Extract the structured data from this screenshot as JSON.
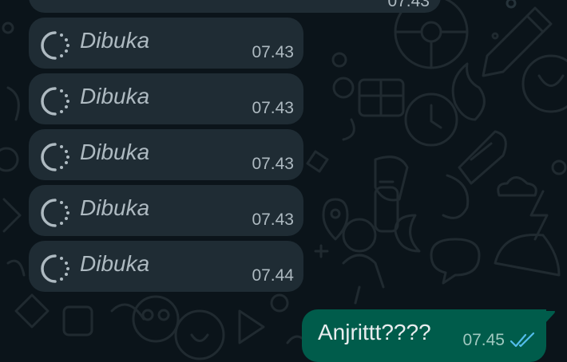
{
  "chat": {
    "top_partial_time": "07.43",
    "messages": [
      {
        "direction": "in",
        "icon": "view-once-icon",
        "text": "Dibuka",
        "time": "07.43"
      },
      {
        "direction": "in",
        "icon": "view-once-icon",
        "text": "Dibuka",
        "time": "07.43"
      },
      {
        "direction": "in",
        "icon": "view-once-icon",
        "text": "Dibuka",
        "time": "07.43"
      },
      {
        "direction": "in",
        "icon": "view-once-icon",
        "text": "Dibuka",
        "time": "07.43"
      },
      {
        "direction": "in",
        "icon": "view-once-icon",
        "text": "Dibuka",
        "time": "07.44"
      },
      {
        "direction": "out",
        "text": "Anjrittt????",
        "time": "07.45",
        "status_icon": "double-check-icon",
        "status_color": "#53bdeb"
      }
    ]
  },
  "colors": {
    "background": "#0b141a",
    "incoming_bubble": "#1f2c34",
    "outgoing_bubble": "#005c4b",
    "read_ticks": "#53bdeb"
  }
}
